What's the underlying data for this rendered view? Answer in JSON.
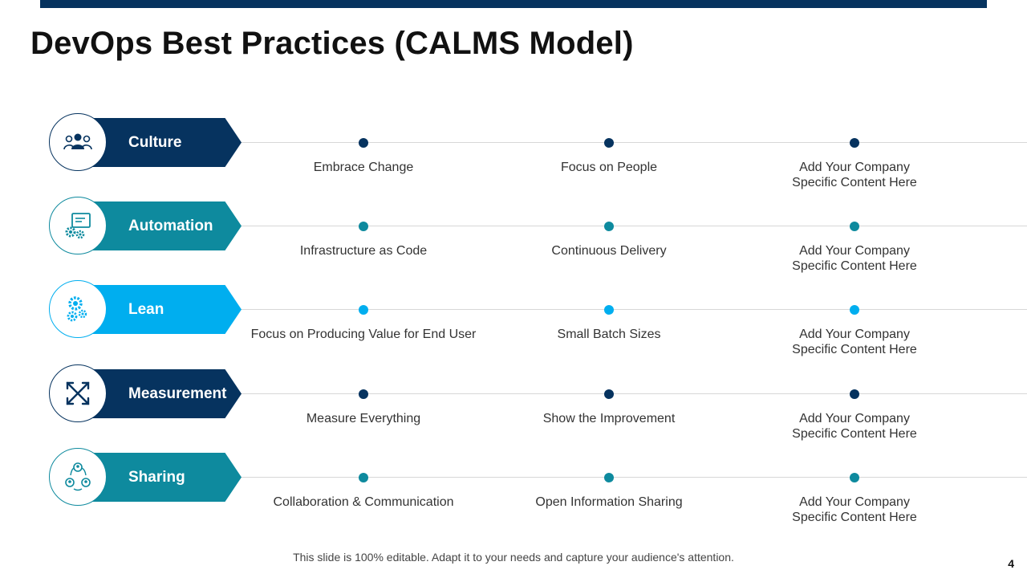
{
  "title": "DevOps Best Practices (CALMS Model)",
  "colors": {
    "navy": "#06335f",
    "teal": "#0e8a9e",
    "sky": "#00aeef",
    "top_bar": "#06335f"
  },
  "rows": [
    {
      "label": "Culture",
      "icon": "people-icon",
      "color": "#06335f",
      "items": [
        "Embrace Change",
        "Focus on People",
        "Add Your Company\nSpecific Content Here"
      ]
    },
    {
      "label": "Automation",
      "icon": "automation-gear-monitor-icon",
      "color": "#0e8a9e",
      "items": [
        "Infrastructure  as Code",
        "Continuous  Delivery",
        "Add Your Company\nSpecific Content Here"
      ]
    },
    {
      "label": "Lean",
      "icon": "lean-gears-icon",
      "color": "#00aeef",
      "items": [
        "Focus on Producing Value for End User",
        "Small Batch Sizes",
        "Add Your Company\nSpecific Content Here"
      ]
    },
    {
      "label": "Measurement",
      "icon": "expand-arrows-icon",
      "color": "#06335f",
      "items": [
        "Measure Everything",
        "Show the Improvement",
        "Add Your Company\nSpecific Content Here"
      ]
    },
    {
      "label": "Sharing",
      "icon": "sharing-people-icon",
      "color": "#0e8a9e",
      "items": [
        "Collaboration & Communication",
        "Open Information  Sharing",
        "Add Your Company\nSpecific Content Here"
      ]
    }
  ],
  "footer_note": "This slide is 100% editable. Adapt it to your needs and capture your audience's attention.",
  "page_number": "4"
}
